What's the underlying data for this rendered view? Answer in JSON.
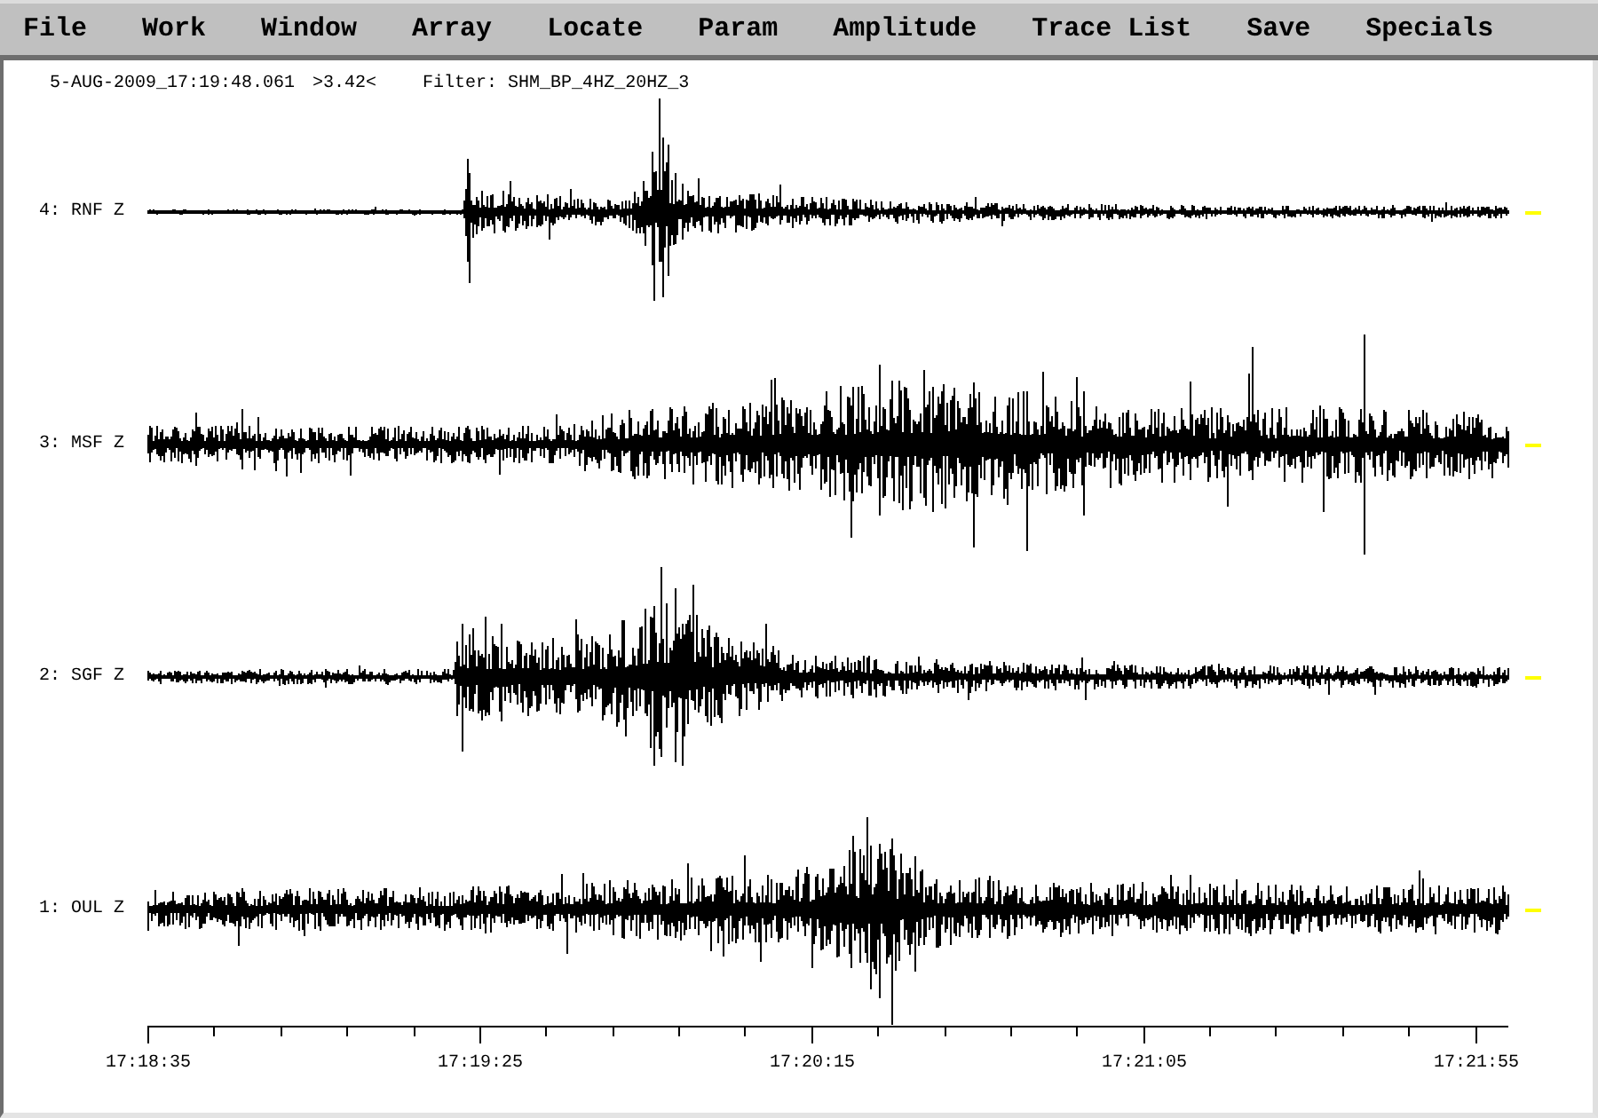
{
  "menu": {
    "items": [
      "File",
      "Work",
      "Window",
      "Array",
      "Locate",
      "Param",
      "Amplitude",
      "Trace List",
      "Save",
      "Specials"
    ]
  },
  "header": {
    "timestamp": "5-AUG-2009_17:19:48.061",
    "value": ">3.42<",
    "filter": "Filter: SHM_BP_4HZ_20HZ_3"
  },
  "traces": [
    {
      "label": "4: RNF Z"
    },
    {
      "label": "3: MSF Z"
    },
    {
      "label": "2: SGF Z"
    },
    {
      "label": "1: OUL Z"
    }
  ],
  "time_axis": {
    "labels": [
      "17:18:35",
      "17:19:25",
      "17:20:15",
      "17:21:05",
      "17:21:55"
    ]
  }
}
